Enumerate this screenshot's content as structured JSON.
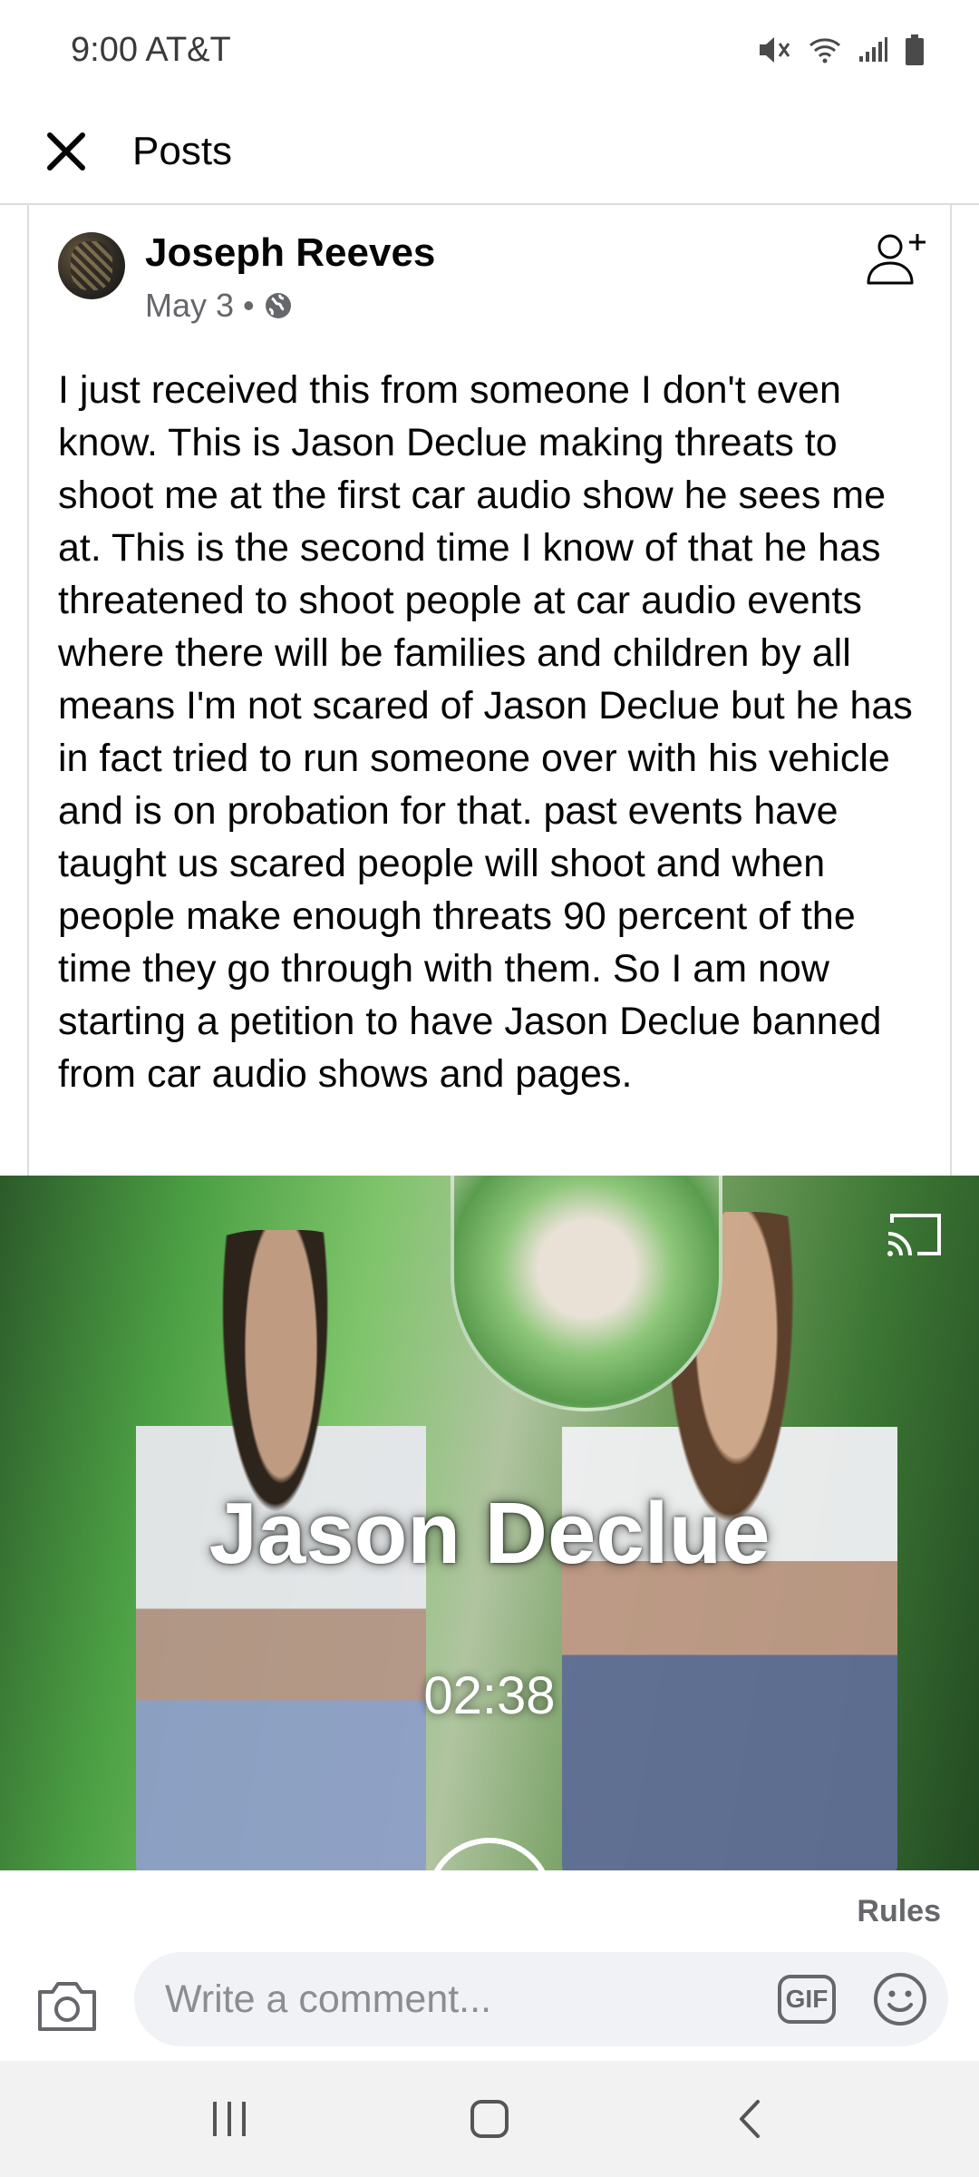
{
  "status_bar": {
    "time_carrier": "9:00 AT&T",
    "icons": [
      "mute-icon",
      "wifi-icon",
      "signal-icon",
      "battery-icon"
    ]
  },
  "header": {
    "title": "Posts",
    "close_icon": "close-icon"
  },
  "post": {
    "author": "Joseph Reeves",
    "date": "May 3 •",
    "privacy_icon": "globe-icon",
    "add_friend_icon": "add-friend-icon",
    "text": "I just received this from someone I don't even know. This is Jason Declue making threats to shoot me at the first car audio show he sees me at. This is the second time I know of that he has threatened to shoot people at car audio events where there will be families and children by all means I'm not scared of Jason Declue but he has in fact tried to run someone over with his vehicle and is on probation for that. past events have taught us scared people will shoot and when people make enough threats 90 percent of the time they go through with them. So I am now starting a petition to have Jason Declue banned from car audio shows and pages."
  },
  "video": {
    "overlay_title": "Jason Declue",
    "duration": "02:38",
    "cast_icon": "cast-icon",
    "play_icon": "play-icon"
  },
  "comment_bar": {
    "rules_label": "Rules",
    "placeholder": "Write a comment...",
    "gif_label": "GIF",
    "camera_icon": "camera-icon",
    "emoji_icon": "emoji-icon"
  },
  "nav_bar": {
    "recents_icon": "recents-icon",
    "home_icon": "home-icon",
    "back_icon": "back-icon"
  },
  "colors": {
    "text_primary": "#050505",
    "text_secondary": "#65676b",
    "input_bg": "#f0f2f5",
    "nav_bg": "#f2f2f2"
  }
}
